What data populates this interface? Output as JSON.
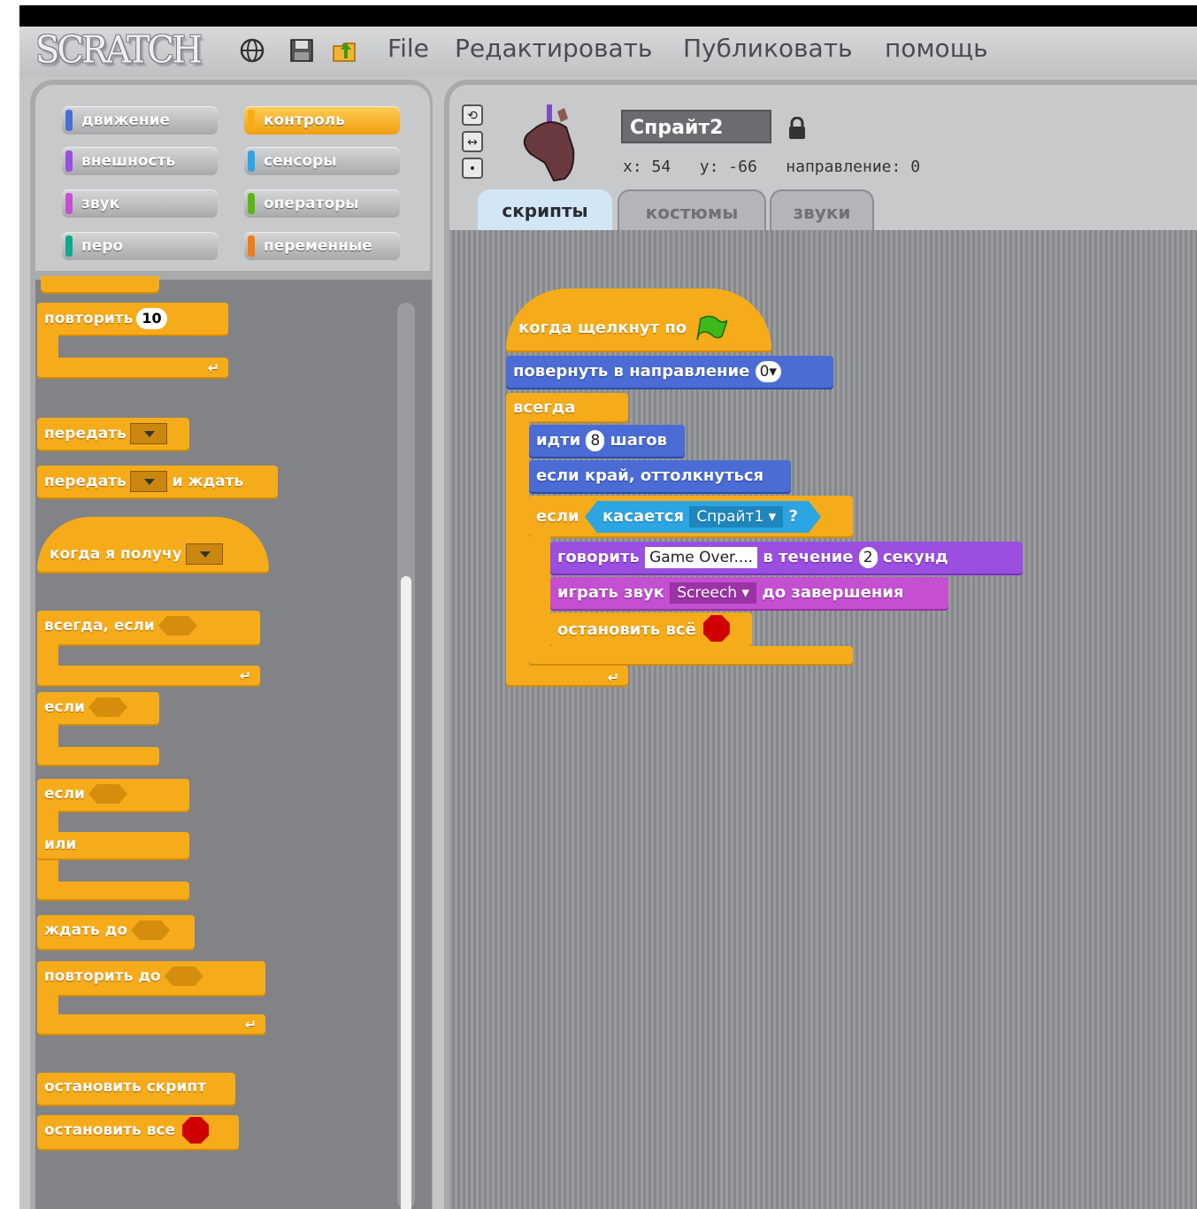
{
  "app": {
    "logo": "SCRATCH"
  },
  "menu": {
    "file": "File",
    "edit": "Редактировать",
    "share": "Публиковать",
    "help": "помощь"
  },
  "categories": {
    "motion": "движение",
    "control": "контроль",
    "looks": "внешность",
    "sensing": "сенсоры",
    "sound": "звук",
    "operators": "операторы",
    "pen": "перо",
    "variables": "переменные"
  },
  "category_colors": {
    "motion": "#4a6cd4",
    "control": "#f6ac1a",
    "looks": "#9a4fe0",
    "sensing": "#2ca5e2",
    "sound": "#c44fd0",
    "operators": "#5cb712",
    "pen": "#0fa98a",
    "variables": "#ee7d16"
  },
  "palette": {
    "repeat": "повторить",
    "repeat_count": "10",
    "broadcast": "передать",
    "broadcast_wait": "передать",
    "and_wait": "и ждать",
    "when_receive": "когда я получу",
    "forever_if": "всегда, если",
    "if": "если",
    "if_else_if": "если",
    "else": "или",
    "wait_until": "ждать до",
    "repeat_until": "повторить до",
    "stop_script": "остановить скрипт",
    "stop_all": "остановить все"
  },
  "sprite": {
    "name": "Спрайт2",
    "x_label": "x:",
    "x": "54",
    "y_label": "y:",
    "y": "-66",
    "direction_label": "направление:",
    "direction": "0"
  },
  "tabs": {
    "scripts": "скрипты",
    "costumes": "костюмы",
    "sounds": "звуки"
  },
  "script": {
    "when_flag": "когда щелкнут по",
    "point_direction": "повернуть в направление",
    "direction_value": "0",
    "forever": "всегда",
    "move": "идти",
    "steps_value": "8",
    "steps": "шагов",
    "bounce": "если край, оттолкнуться",
    "if": "если",
    "touching": "касается",
    "touching_target": "Спрайт1",
    "question": "?",
    "say": "говорить",
    "say_text": "Game Over....",
    "for": "в течение",
    "seconds_value": "2",
    "seconds": "секунд",
    "play_sound": "играть звук",
    "sound_name": "Screech",
    "until_done": "до завершения",
    "stop_all": "остановить всё"
  }
}
